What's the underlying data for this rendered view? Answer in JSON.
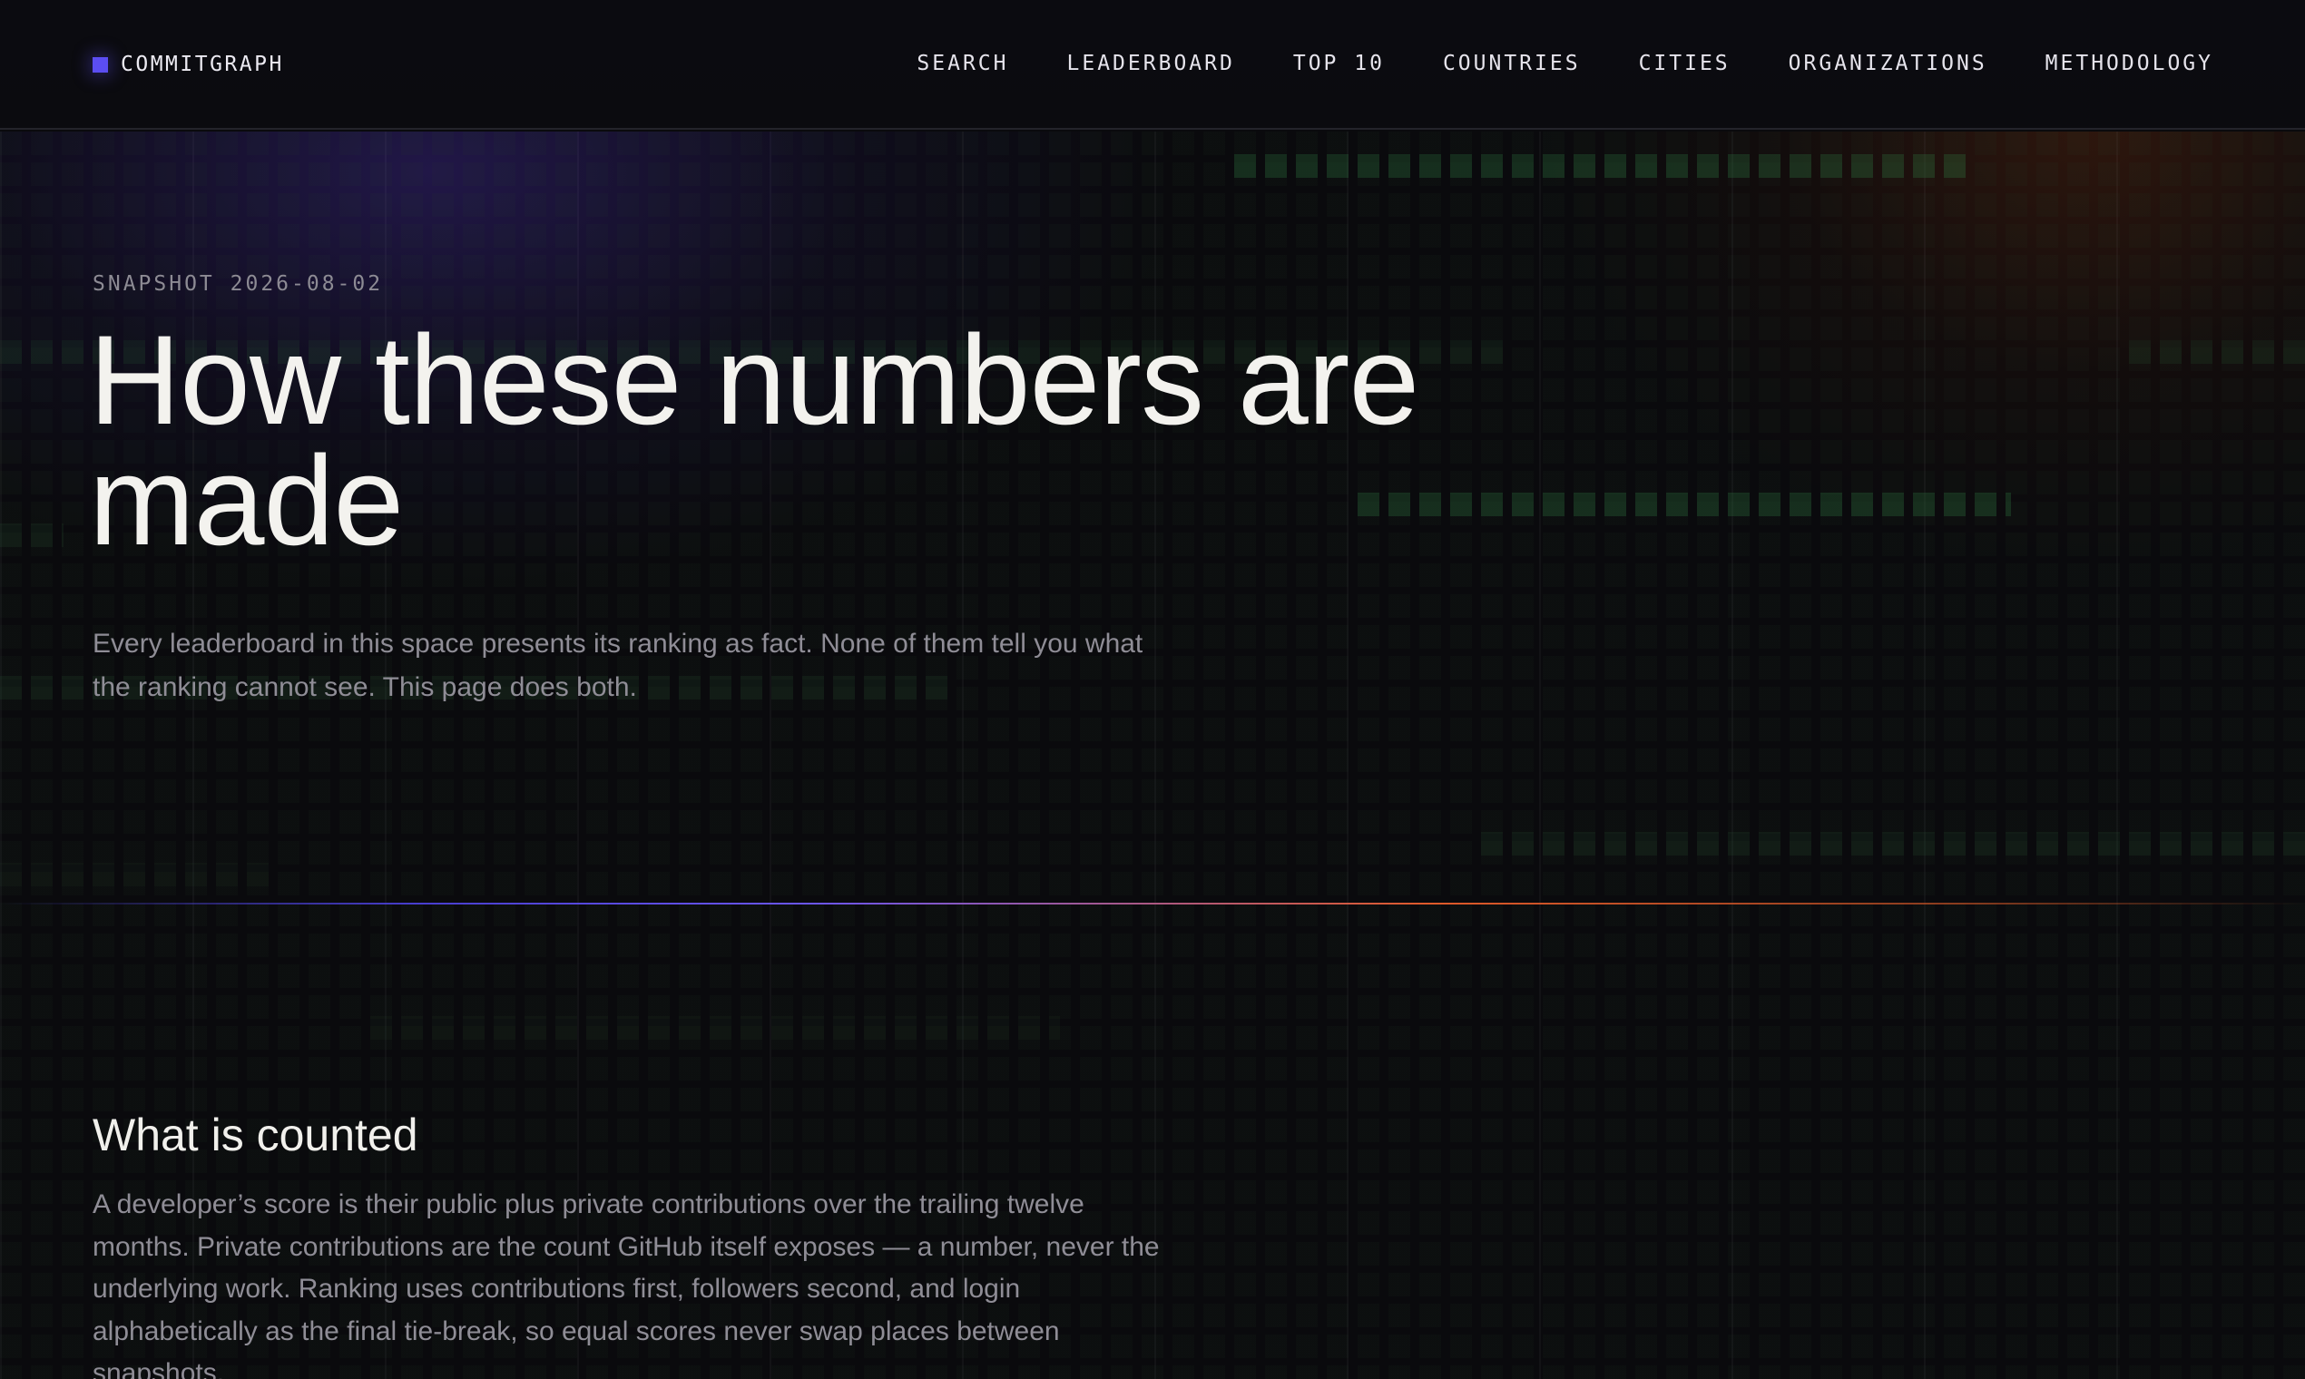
{
  "brand": {
    "name": "COMMITGRAPH",
    "accent": "#5b4df2"
  },
  "nav": {
    "items": [
      {
        "label": "SEARCH"
      },
      {
        "label": "LEADERBOARD"
      },
      {
        "label": "TOP 10"
      },
      {
        "label": "COUNTRIES"
      },
      {
        "label": "CITIES"
      },
      {
        "label": "ORGANIZATIONS"
      },
      {
        "label": "METHODOLOGY"
      }
    ]
  },
  "hero": {
    "snapshot": "SNAPSHOT 2026-08-02",
    "title": "How these numbers are made",
    "lede": "Every leaderboard in this space presents its ranking as fact. None of them tell you what the ranking cannot see. This page does both."
  },
  "sections": [
    {
      "title": "What is counted",
      "body": "A developer’s score is their public plus private contributions over the trailing twelve months. Private contributions are the count GitHub itself exposes — a number, never the underlying work. Ranking uses contributions first, followers second, and login alphabetically as the final tie-break, so equal scores never swap places between snapshots."
    }
  ],
  "colors": {
    "background": "#0a0a0d",
    "divider_start": "#5246f0",
    "divider_end": "#e05a2a",
    "cell_green": "#2e7840"
  }
}
